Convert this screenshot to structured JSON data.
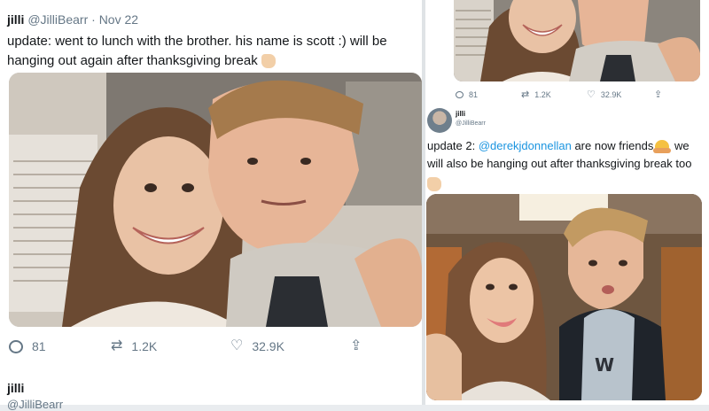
{
  "left_tweet": {
    "name": "jilli",
    "handle": "@JilliBearr",
    "separator": "·",
    "date": "Nov 22",
    "text": "update: went to lunch with the brother. his name is scott :) will be hanging out again after thanksgiving break",
    "actions": {
      "replies": "81",
      "retweets": "1.2K",
      "likes": "32.9K"
    }
  },
  "left_next_tweet": {
    "name": "jilli",
    "handle": "@JilliBearr"
  },
  "right_top_tweet": {
    "actions": {
      "replies": "81",
      "retweets": "1.2K",
      "likes": "32.9K"
    }
  },
  "right_tweet": {
    "name": "jilli",
    "handle": "@JilliBearr",
    "text_prefix": "update 2: ",
    "mention": "@derekjdonnellan",
    "text_middle": " are now friends",
    "text_suffix": " we will also be hanging out after thanksgiving break too"
  },
  "icons": {
    "reply": "comment-icon",
    "retweet": "retweet-icon",
    "like": "heart-icon",
    "share": "share-icon"
  },
  "colors": {
    "secondary_text": "#657786",
    "mention": "#1b95e0"
  }
}
